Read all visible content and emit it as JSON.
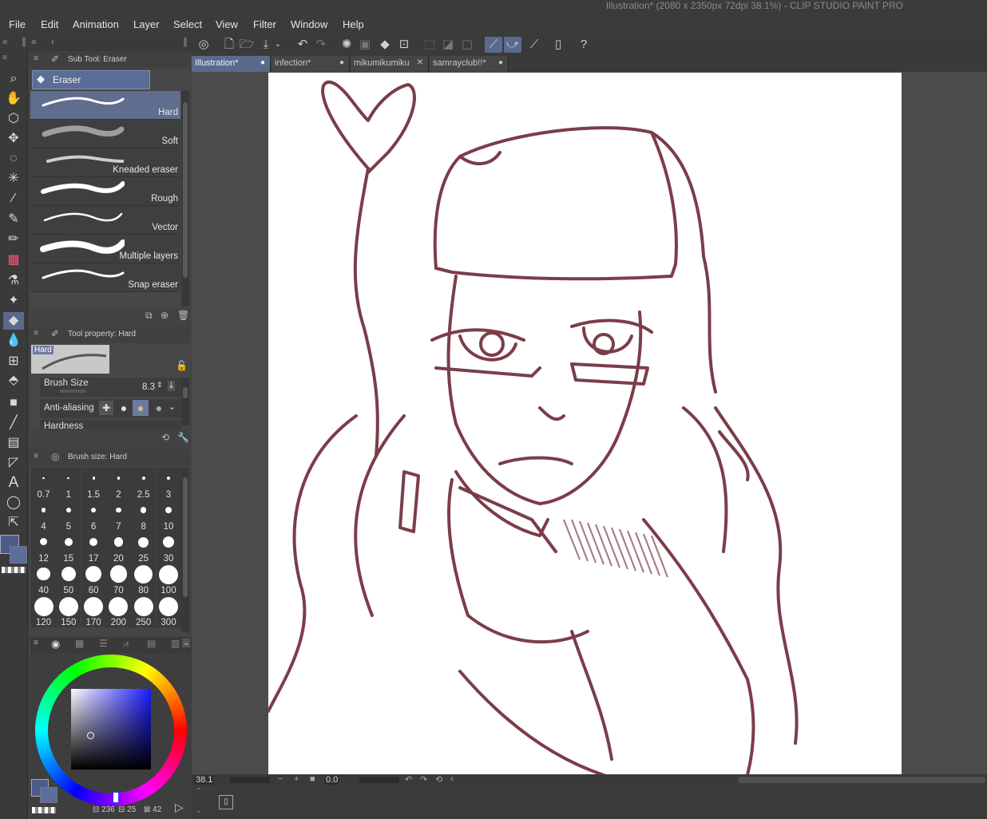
{
  "window": {
    "title": "Illustration* (2080 x 2350px 72dpi 38.1%)  - CLIP STUDIO PAINT PRO"
  },
  "menu": [
    "File",
    "Edit",
    "Animation",
    "Layer",
    "Select",
    "View",
    "Filter",
    "Window",
    "Help"
  ],
  "tabs": [
    {
      "label": "Illustration*",
      "close": "●",
      "active": true
    },
    {
      "label": "infection*",
      "close": "●",
      "active": false
    },
    {
      "label": "mikumikumiku",
      "close": "✕",
      "active": false
    },
    {
      "label": "samrayclub!!*",
      "close": "●",
      "active": false
    }
  ],
  "subtool": {
    "header": "Sub Tool: Eraser",
    "group": "Eraser",
    "items": [
      "Hard",
      "Soft",
      "Kneaded eraser",
      "Rough",
      "Vector",
      "Multiple layers",
      "Snap eraser"
    ],
    "selected": "Hard"
  },
  "tool_property": {
    "header": "Tool property: Hard",
    "preview_label": "Hard",
    "brush_size_label": "Brush Size",
    "brush_size_value": "8.3",
    "anti_aliasing_label": "Anti-aliasing",
    "hardness_label": "Hardness"
  },
  "brush_size": {
    "header": "Brush size: Hard",
    "sizes": [
      "0.7",
      "1",
      "1.5",
      "2",
      "2.5",
      "3",
      "4",
      "5",
      "6",
      "7",
      "8",
      "10",
      "12",
      "15",
      "17",
      "20",
      "25",
      "30",
      "40",
      "50",
      "60",
      "70",
      "80",
      "100",
      "120",
      "150",
      "170",
      "200",
      "250",
      "300"
    ]
  },
  "color": {
    "main": "#4e5a8a",
    "sub": "#5b6e9c",
    "values": [
      "236",
      "25",
      "42"
    ]
  },
  "status": {
    "zoom": "38.1",
    "rotation": "0.0"
  },
  "icons": {
    "toolbar": [
      "zoom-icon",
      "hand-icon",
      "operation-icon",
      "move-layer-icon",
      "lasso-select-icon",
      "auto-select-icon",
      "eyedropper-icon",
      "pen-icon",
      "pencil-icon",
      "brush-icon",
      "airbrush-icon",
      "decoration-icon",
      "eraser-icon",
      "blend-icon",
      "fill-icon",
      "gradient-icon",
      "figure-icon",
      "frame-icon",
      "ruler-icon",
      "text-icon",
      "balloon-icon",
      "correct-line-icon"
    ]
  }
}
